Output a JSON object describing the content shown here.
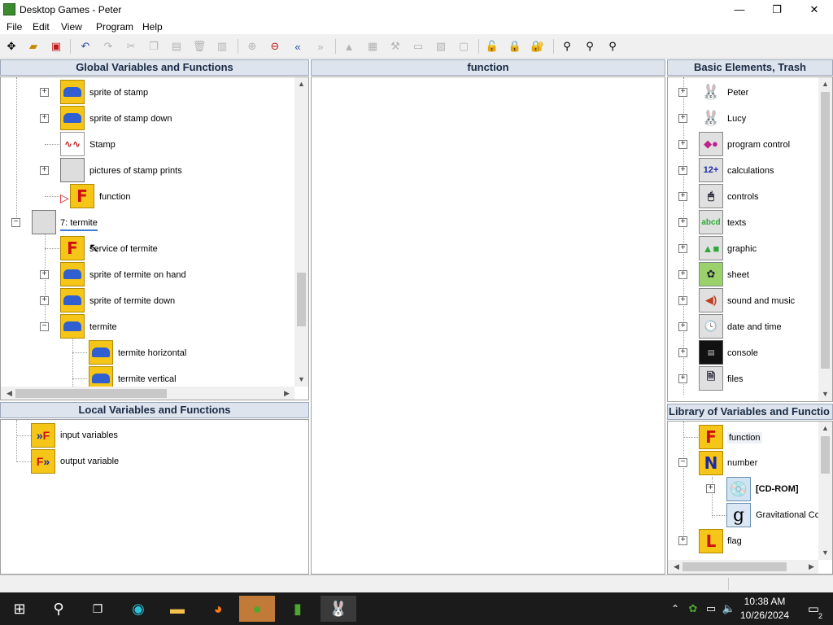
{
  "window": {
    "title": "Desktop Games - Peter",
    "minimize": "—",
    "restore": "❐",
    "close": "✕"
  },
  "menu": [
    "File",
    "Edit",
    "View",
    "Program",
    "Help"
  ],
  "toolbar": [
    "new-icon",
    "open-icon",
    "save-icon",
    "undo-icon",
    "redo-icon",
    "cut-icon",
    "copy-icon",
    "paste-icon",
    "delete-icon",
    "clear-icon",
    "zoom-in-icon",
    "zoom-out-icon",
    "back-icon",
    "forward-icon",
    "lock-icon",
    "align-icon",
    "tool-icon",
    "input-icon",
    "output-icon",
    "frame-icon",
    "lock-open-icon",
    "lock-partial-icon",
    "lock-closed-icon",
    "find-icon",
    "find-next-icon",
    "find-all-icon"
  ],
  "global_panel": {
    "header": "Global Variables and Functions",
    "items": [
      {
        "label": "sprite of stamp",
        "icon": "car-icon",
        "expander": "+"
      },
      {
        "label": "sprite of stamp down",
        "icon": "car-icon",
        "expander": "+"
      },
      {
        "label": "Stamp",
        "icon": "wave-icon",
        "expander": ""
      },
      {
        "label": "pictures of stamp prints",
        "icon": "grid-icon",
        "expander": "+"
      },
      {
        "label": "function",
        "icon": "function-F-icon",
        "expander": ""
      },
      {
        "label": "7: termite",
        "icon": "grid-icon",
        "expander": "−"
      },
      {
        "label": "service of termite",
        "icon": "function-F-icon",
        "expander": ""
      },
      {
        "label": "sprite of termite on hand",
        "icon": "car-icon",
        "expander": "+"
      },
      {
        "label": "sprite of termite down",
        "icon": "car-icon",
        "expander": "+"
      },
      {
        "label": "termite",
        "icon": "car-icon",
        "expander": "−"
      },
      {
        "label": "termite horizontal",
        "icon": "car-icon",
        "expander": ""
      },
      {
        "label": "termite vertical",
        "icon": "car-icon",
        "expander": ""
      }
    ]
  },
  "function_panel": {
    "header": "function"
  },
  "local_panel": {
    "header": "Local Variables and Functions",
    "items": [
      {
        "label": "input variables",
        "icon": "input-arrows-icon"
      },
      {
        "label": "output variable",
        "icon": "output-arrows-icon"
      }
    ]
  },
  "basic_panel": {
    "header": "Basic Elements, Trash",
    "items": [
      {
        "label": "Peter",
        "icon": "bunny-peter-icon"
      },
      {
        "label": "Lucy",
        "icon": "bunny-lucy-icon"
      },
      {
        "label": "program control",
        "icon": "shapes-icon"
      },
      {
        "label": "calculations",
        "icon": "math-icon"
      },
      {
        "label": "controls",
        "icon": "controls-icon"
      },
      {
        "label": "texts",
        "icon": "texts-icon"
      },
      {
        "label": "graphic",
        "icon": "graphic-icon"
      },
      {
        "label": "sheet",
        "icon": "sheet-icon"
      },
      {
        "label": "sound and music",
        "icon": "speaker-icon"
      },
      {
        "label": "date and time",
        "icon": "clock-icon"
      },
      {
        "label": "console",
        "icon": "console-icon"
      },
      {
        "label": "files",
        "icon": "files-icon"
      }
    ]
  },
  "library_panel": {
    "header": "Library of Variables and Functio",
    "items": [
      {
        "label": "function",
        "icon": "function-F-icon",
        "expander": ""
      },
      {
        "label": "number",
        "icon": "number-N-icon",
        "expander": "−"
      },
      {
        "label": "[CD-ROM]",
        "icon": "cd-icon",
        "expander": "+"
      },
      {
        "label": "Gravitational Co",
        "icon": "g-icon",
        "expander": ""
      },
      {
        "label": "flag",
        "icon": "flag-L-icon",
        "expander": "+"
      }
    ]
  },
  "taskbar": {
    "time": "10:38 AM",
    "date": "10/26/2024",
    "notification_count": "2",
    "apps": [
      "start-icon",
      "search-icon",
      "task-view-icon",
      "edge-icon",
      "explorer-icon",
      "firefox-icon",
      "frog-icon",
      "chart-icon",
      "bunny-app-icon"
    ]
  }
}
